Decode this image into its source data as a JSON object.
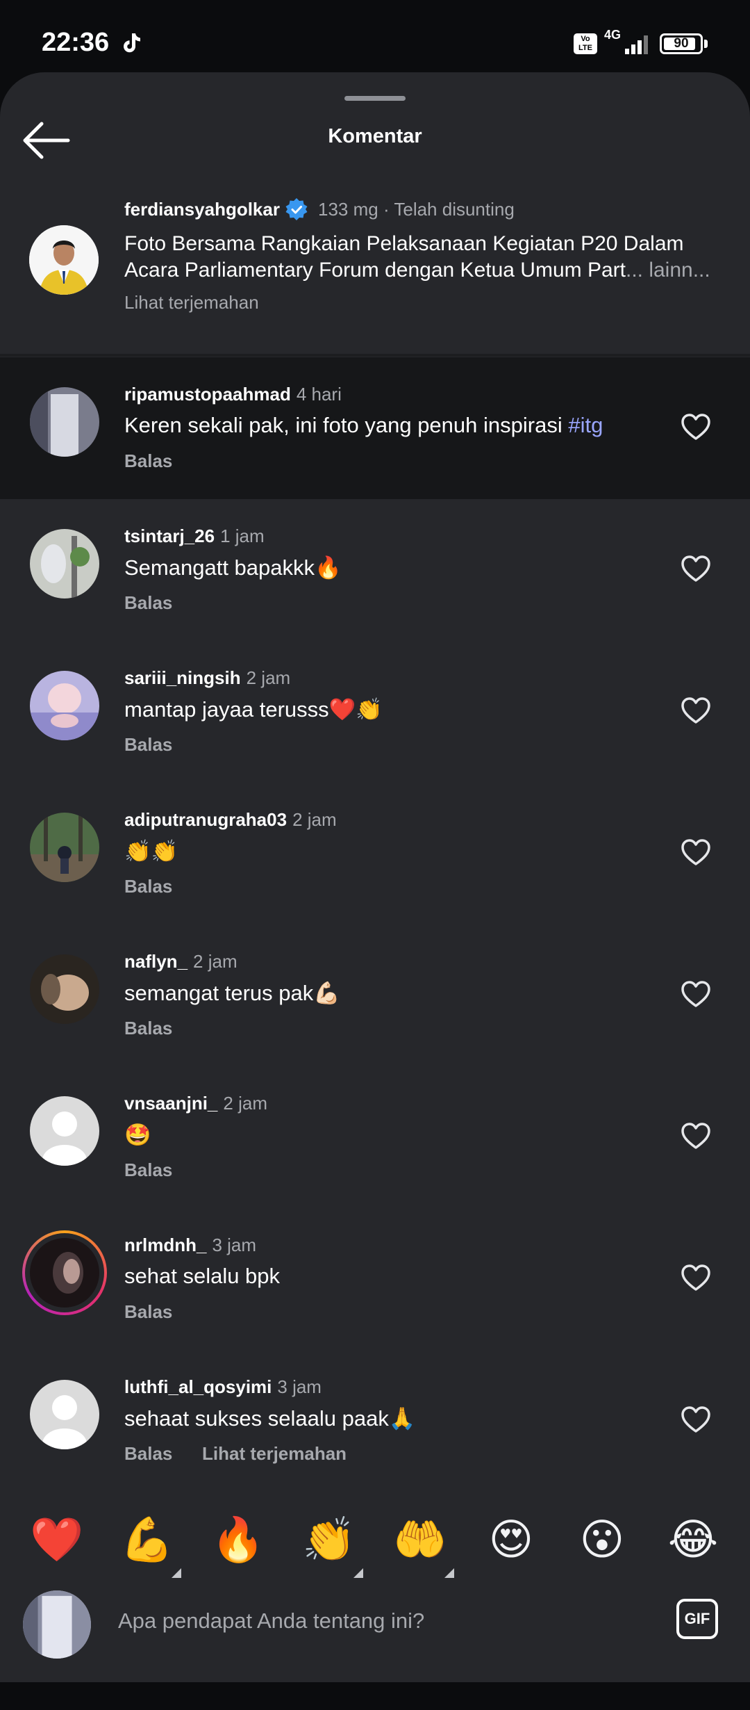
{
  "status_bar": {
    "time": "22:36",
    "volte": "Vo LTE",
    "network": "4G",
    "battery": "90",
    "battery_level": 0.9
  },
  "header": {
    "title": "Komentar"
  },
  "caption": {
    "username": "ferdiansyahgolkar",
    "verified": true,
    "meta": "133 mg · Telah disunting",
    "text_line1": "Foto Bersama Rangkaian Pelaksanaan Kegiatan P20 Dalam",
    "text_line2": "Acara Parliamentary Forum dengan Ketua Umum Part",
    "more": "... lainn...",
    "translate": "Lihat terjemahan"
  },
  "comments": [
    {
      "username": "ripamustopaahmad",
      "time": "4 hari",
      "text": "Keren sekali pak, ini foto yang penuh inspirasi ",
      "hashtag": "#itg",
      "reply": "Balas"
    },
    {
      "username": "tsintarj_26",
      "time": "1 jam",
      "text": "Semangatt bapakkk🔥",
      "reply": "Balas"
    },
    {
      "username": "sariii_ningsih",
      "time": "2 jam",
      "text": "mantap jayaa terusss❤️👏",
      "reply": "Balas"
    },
    {
      "username": "adiputranugraha03",
      "time": "2 jam",
      "text": "👏👏",
      "reply": "Balas"
    },
    {
      "username": "naflyn_",
      "time": "2 jam",
      "text": "semangat terus pak💪🏻",
      "reply": "Balas"
    },
    {
      "username": "vnsaanjni_",
      "time": "2 jam",
      "text": "🤩",
      "reply": "Balas"
    },
    {
      "username": "nrlmdnh_",
      "time": "3 jam",
      "text": "sehat selalu bpk",
      "reply": "Balas"
    },
    {
      "username": "luthfi_al_qosyimi",
      "time": "3 jam",
      "text": "sehaat sukses selaalu paak🙏",
      "reply": "Balas",
      "translate": "Lihat terjemahan"
    }
  ],
  "emoji_bar": [
    "❤️",
    "💪",
    "🔥",
    "👏",
    "🤲",
    "😍",
    "😮",
    "😂"
  ],
  "input": {
    "placeholder": "Apa pendapat Anda tentang ini?",
    "gif_label": "GIF"
  },
  "colors": {
    "sheet_bg": "#26272b",
    "highlight_bg": "#161719",
    "muted_text": "#a7a9ae",
    "hashtag": "#9aa6ff",
    "verified_badge": "#3897f0"
  }
}
